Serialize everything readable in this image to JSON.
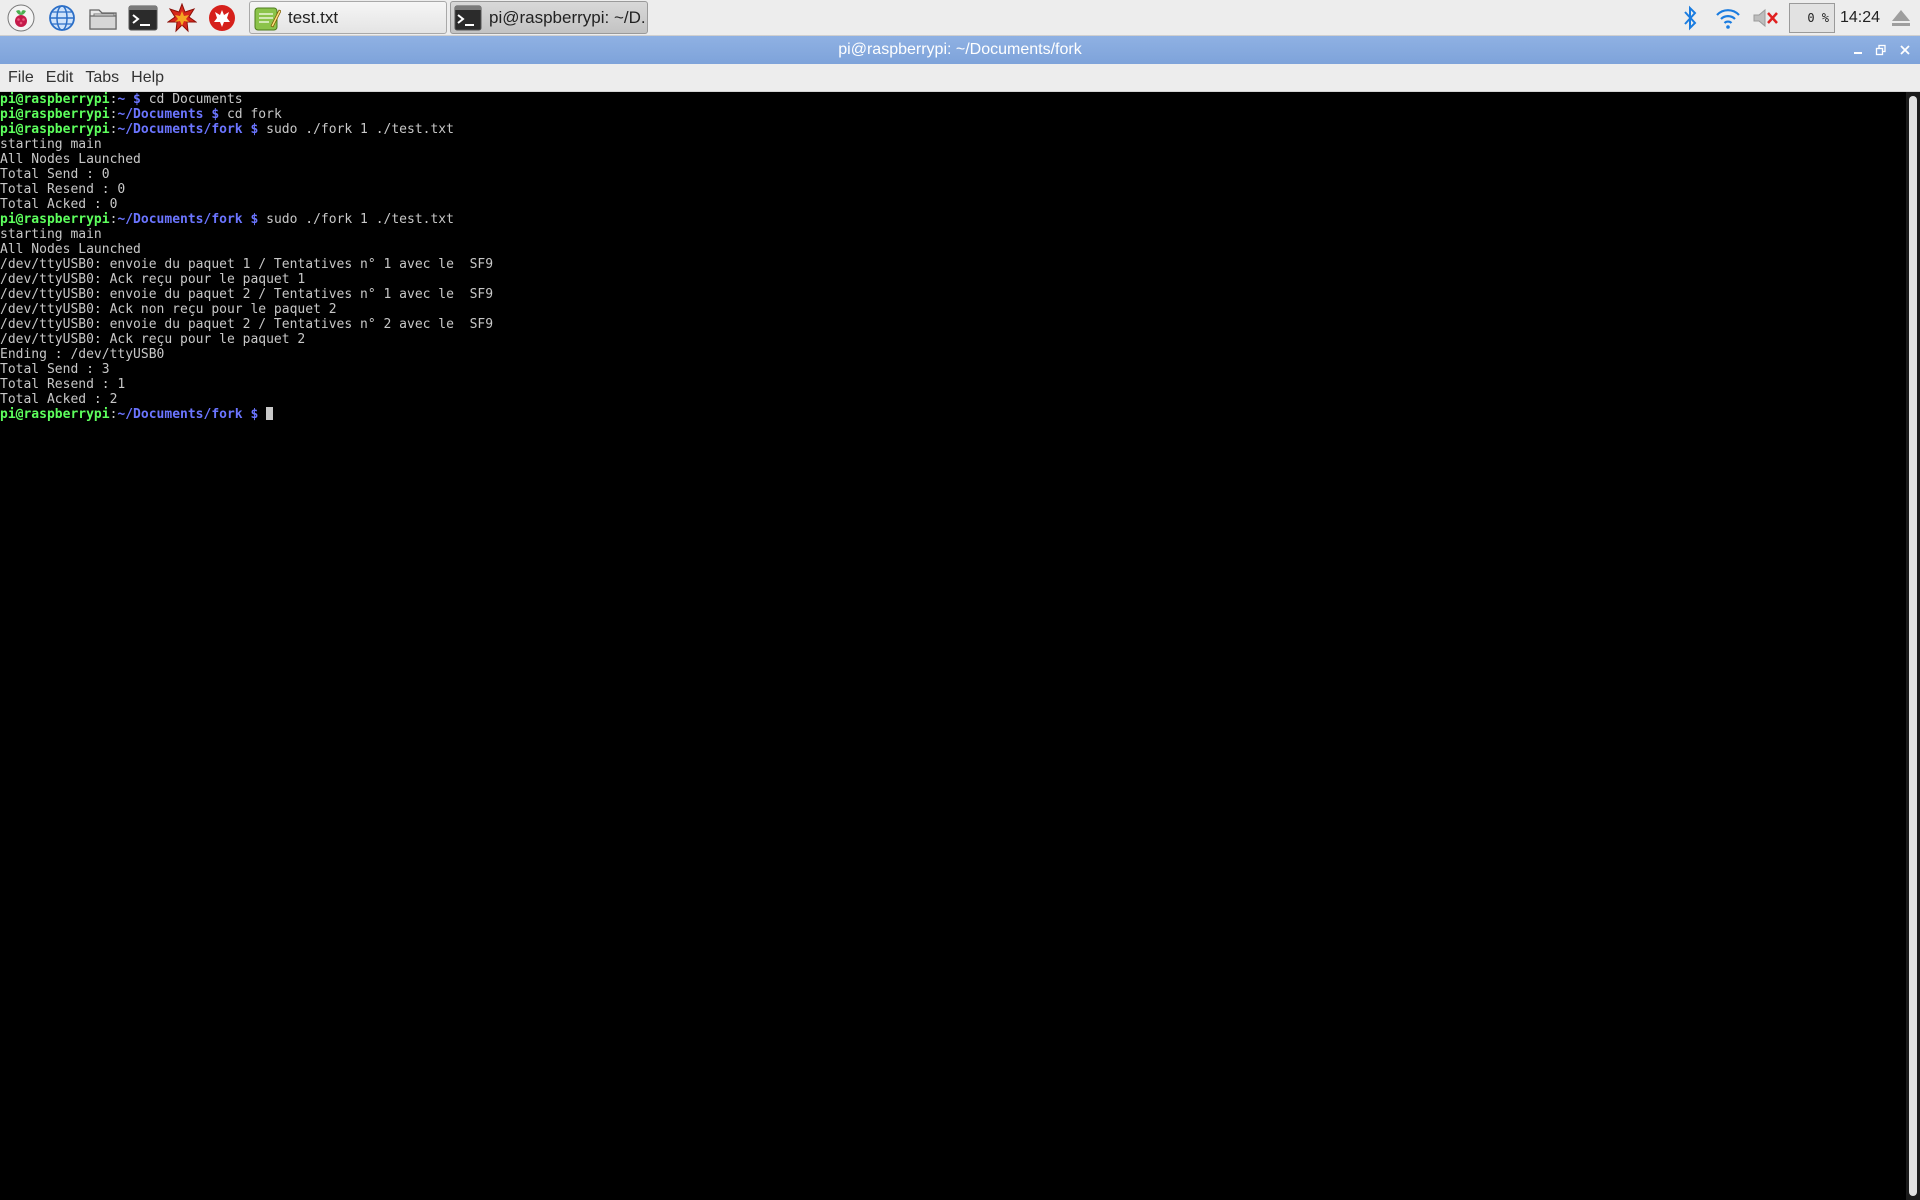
{
  "taskbar": {
    "launchers": [
      {
        "name": "raspberry-menu-icon"
      },
      {
        "name": "web-browser-icon"
      },
      {
        "name": "file-manager-icon"
      },
      {
        "name": "terminal-icon"
      },
      {
        "name": "mathematica-icon"
      },
      {
        "name": "wolfram-icon"
      }
    ],
    "tasks": [
      {
        "label": "test.txt",
        "icon": "text-editor-icon",
        "active": false
      },
      {
        "label": "pi@raspberrypi: ~/D...",
        "icon": "terminal-icon",
        "active": true
      }
    ],
    "cpu_usage": "0 %",
    "clock": "14:24"
  },
  "window": {
    "title": "pi@raspberrypi: ~/Documents/fork",
    "menus": [
      "File",
      "Edit",
      "Tabs",
      "Help"
    ]
  },
  "terminal": {
    "user_host": "pi@raspberrypi",
    "lines": [
      {
        "prompt": true,
        "path": "~",
        "cmd": "cd Documents"
      },
      {
        "prompt": true,
        "path": "~/Documents",
        "cmd": "cd fork"
      },
      {
        "prompt": true,
        "path": "~/Documents/fork",
        "cmd": "sudo ./fork 1 ./test.txt"
      },
      {
        "text": "starting main"
      },
      {
        "text": "All Nodes Launched"
      },
      {
        "text": "Total Send : 0"
      },
      {
        "text": "Total Resend : 0"
      },
      {
        "text": "Total Acked : 0"
      },
      {
        "prompt": true,
        "path": "~/Documents/fork",
        "cmd": "sudo ./fork 1 ./test.txt"
      },
      {
        "text": "starting main"
      },
      {
        "text": "All Nodes Launched"
      },
      {
        "text": "/dev/ttyUSB0: envoie du paquet 1 / Tentatives n° 1 avec le  SF9"
      },
      {
        "text": "/dev/ttyUSB0: Ack reçu pour le paquet 1"
      },
      {
        "text": "/dev/ttyUSB0: envoie du paquet 2 / Tentatives n° 1 avec le  SF9"
      },
      {
        "text": "/dev/ttyUSB0: Ack non reçu pour le paquet 2"
      },
      {
        "text": "/dev/ttyUSB0: envoie du paquet 2 / Tentatives n° 2 avec le  SF9"
      },
      {
        "text": "/dev/ttyUSB0: Ack reçu pour le paquet 2"
      },
      {
        "text": "Ending : /dev/ttyUSB0"
      },
      {
        "text": "Total Send : 3"
      },
      {
        "text": "Total Resend : 1"
      },
      {
        "text": "Total Acked : 2"
      },
      {
        "prompt": true,
        "path": "~/Documents/fork",
        "cmd": "",
        "cursor": true
      }
    ]
  },
  "colors": {
    "prompt_user": "#5dff5d",
    "prompt_path": "#6b75ff",
    "terminal_text": "#c8c8c8",
    "titlebar": "#87aade"
  }
}
